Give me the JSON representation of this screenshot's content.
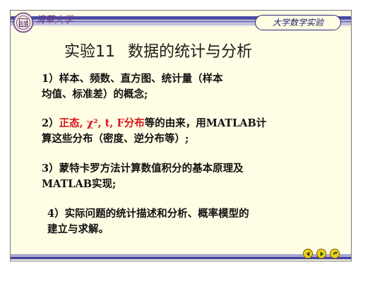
{
  "header": {
    "logo_text": "清華",
    "calligraphy_text": "清華大學",
    "course_title": "大学数学实验"
  },
  "slide": {
    "number": "实验11",
    "title": "数据的统计与分析"
  },
  "items": [
    {
      "line1": "1）样本、频数、直方图、统计量（样本",
      "line2": "均值、标准差）的概念;"
    },
    {
      "prefix": "2）",
      "highlight": "正态, χ², t, F分布",
      "rest": "等的由来，用MATLAB计",
      "line2": "算这些分布（密度、逆分布等）;"
    },
    {
      "line1": "3）蒙特卡罗方法计算数值积分的基本原理及",
      "line2": "MATLAB实现;"
    },
    {
      "line1": "4）实际问题的统计描述和分析、概率模型的",
      "line2": "建立与求解。"
    }
  ],
  "nav": {
    "buttons": [
      "back-icon",
      "play-icon",
      "return-icon"
    ],
    "button_color": "#f0d020"
  },
  "colors": {
    "background": "#fffde4",
    "band": "#4a4aa6",
    "highlight": "#d8141a"
  }
}
